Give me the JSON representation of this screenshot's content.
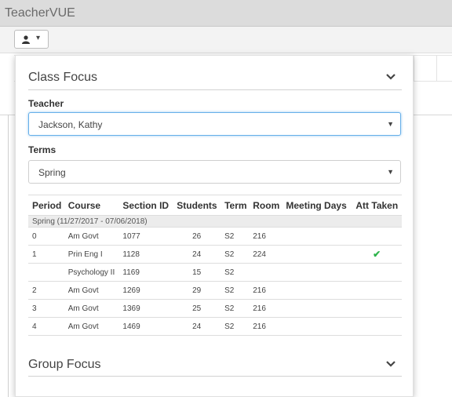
{
  "window": {
    "title": "TeacherVUE"
  },
  "toolbar": {
    "user_icon": "user-icon",
    "dropdown_icon": "caret-down-icon"
  },
  "class_focus": {
    "title": "Class Focus",
    "teacher": {
      "label": "Teacher",
      "value": "Jackson, Kathy"
    },
    "terms": {
      "label": "Terms",
      "value": "Spring"
    },
    "table": {
      "headers": [
        "Period",
        "Course",
        "Section ID",
        "Students",
        "Term",
        "Room",
        "Meeting Days",
        "Att Taken"
      ],
      "group_label": "Spring (11/27/2017 - 07/06/2018)",
      "rows": [
        {
          "period": "0",
          "course": "Am Govt",
          "section": "1077",
          "students": "26",
          "term": "S2",
          "room": "216",
          "days": "",
          "att": ""
        },
        {
          "period": "1",
          "course": "Prin Eng I",
          "section": "1128",
          "students": "24",
          "term": "S2",
          "room": "224",
          "days": "",
          "att": "✔"
        },
        {
          "period": "",
          "course": "Psychology II",
          "section": "1169",
          "students": "15",
          "term": "S2",
          "room": "",
          "days": "",
          "att": ""
        },
        {
          "period": "2",
          "course": "Am Govt",
          "section": "1269",
          "students": "29",
          "term": "S2",
          "room": "216",
          "days": "",
          "att": ""
        },
        {
          "period": "3",
          "course": "Am Govt",
          "section": "1369",
          "students": "25",
          "term": "S2",
          "room": "216",
          "days": "",
          "att": ""
        },
        {
          "period": "4",
          "course": "Am Govt",
          "section": "1469",
          "students": "24",
          "term": "S2",
          "room": "216",
          "days": "",
          "att": ""
        }
      ]
    }
  },
  "group_focus": {
    "title": "Group Focus"
  },
  "colors": {
    "accent_focus": "#66afe9",
    "check": "#2db34a"
  }
}
